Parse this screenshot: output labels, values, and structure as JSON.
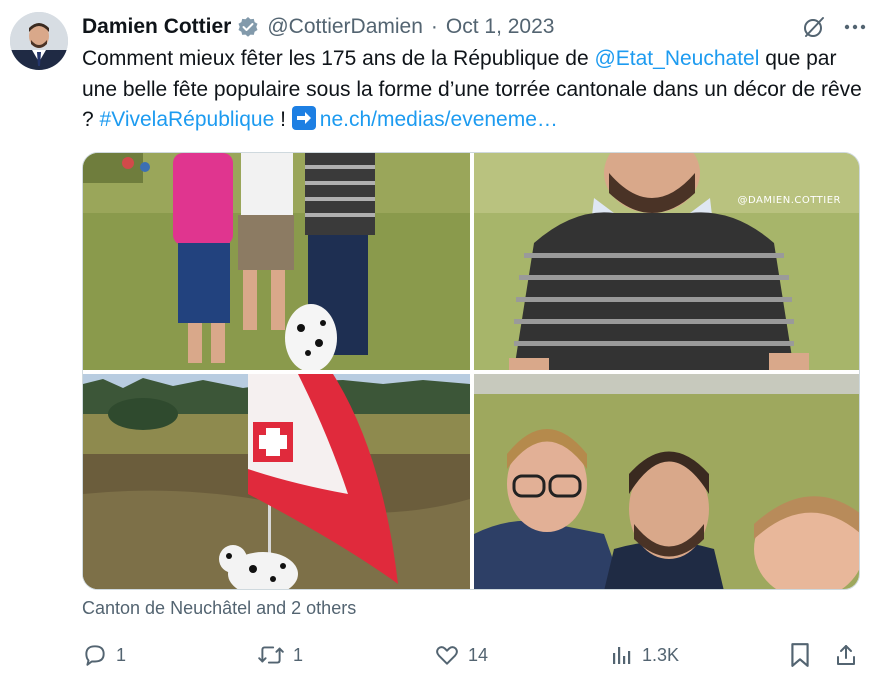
{
  "author": {
    "name": "Damien Cottier",
    "handle": "@CottierDamien",
    "separator": "·",
    "date": "Oct 1, 2023",
    "verified": true
  },
  "text": {
    "part1": "Comment mieux fêter les 175 ans de la République de ",
    "mention": "@Etat_Neuchatel",
    "part2": " que par une belle fête populaire sous la forme d’une torrée cantonale dans un décor de rêve ? ",
    "hashtag": "#VivelaRépublique",
    "part3": " ! ",
    "link": "ne.ch/medias/eveneme…"
  },
  "media": {
    "watermark": "@DAMIEN.COTTIER",
    "photos": [
      "group-with-dalmatian",
      "man-striped-shirt",
      "neuchatel-flag-meadow",
      "group-selfie"
    ]
  },
  "location": "Canton de Neuchâtel and 2 others",
  "actions": {
    "replies": "1",
    "reposts": "1",
    "likes": "14",
    "views": "1.3K"
  },
  "colors": {
    "accent": "#1d9bf0",
    "text": "#0f1419",
    "secondary": "#536471",
    "border": "#cfd9de"
  }
}
